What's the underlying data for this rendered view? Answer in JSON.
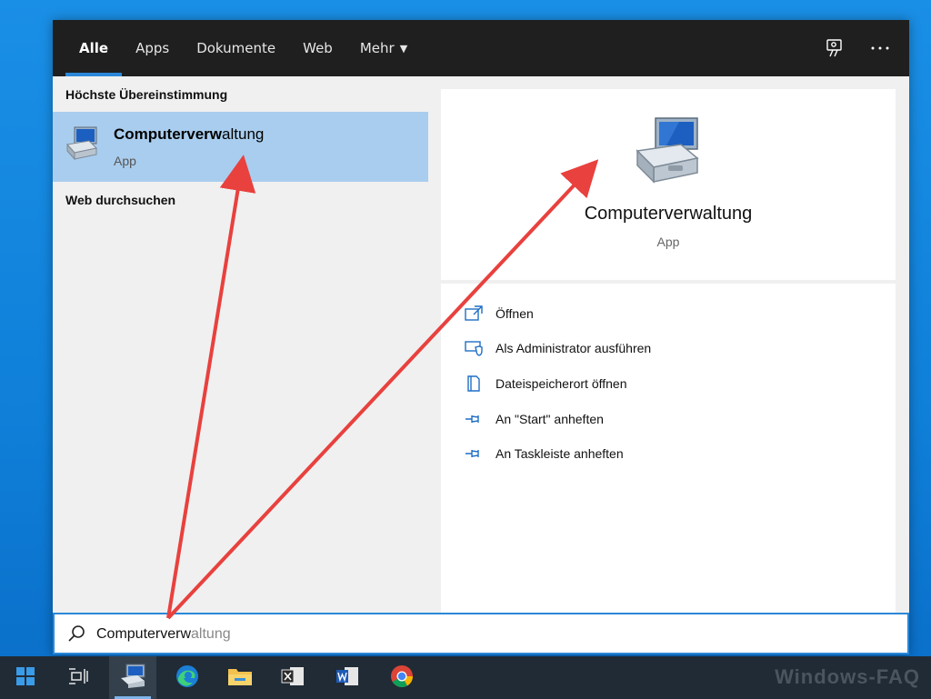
{
  "tabs": [
    {
      "label": "Alle",
      "active": true
    },
    {
      "label": "Apps",
      "active": false
    },
    {
      "label": "Dokumente",
      "active": false
    },
    {
      "label": "Web",
      "active": false
    },
    {
      "label": "Mehr",
      "active": false,
      "has_dropdown": true
    }
  ],
  "topbar_icons": [
    "feedback-icon",
    "more-options-icon"
  ],
  "left": {
    "best_match_header": "Höchste Übereinstimmung",
    "best_match": {
      "title_bold": "Computerverw",
      "title_rest": "altung",
      "subtitle": "App",
      "icon": "computer-management-icon"
    },
    "web_header": "Web durchsuchen"
  },
  "detail": {
    "title": "Computerverwaltung",
    "subtitle": "App",
    "icon": "computer-management-icon"
  },
  "actions": [
    {
      "label": "Öffnen",
      "icon": "open-icon"
    },
    {
      "label": "Als Administrator ausführen",
      "icon": "admin-shield-icon"
    },
    {
      "label": "Dateispeicherort öffnen",
      "icon": "file-location-icon"
    },
    {
      "label": "An \"Start\" anheften",
      "icon": "pin-icon"
    },
    {
      "label": "An Taskleiste anheften",
      "icon": "pin-icon"
    }
  ],
  "search": {
    "typed": "Computerverw",
    "suggestion": "altung",
    "icon": "search-icon"
  },
  "taskbar": {
    "items": [
      "start-icon",
      "task-view-icon",
      "computer-management-icon",
      "edge-icon",
      "file-explorer-icon",
      "excel-icon",
      "word-icon",
      "chrome-icon"
    ],
    "active": "computer-management-icon"
  },
  "watermark": "Windows-FAQ",
  "colors": {
    "accent": "#2b88d8",
    "selection": "#a9cdee",
    "topbar": "#1f1f1f",
    "arrow": "#e8413e"
  }
}
